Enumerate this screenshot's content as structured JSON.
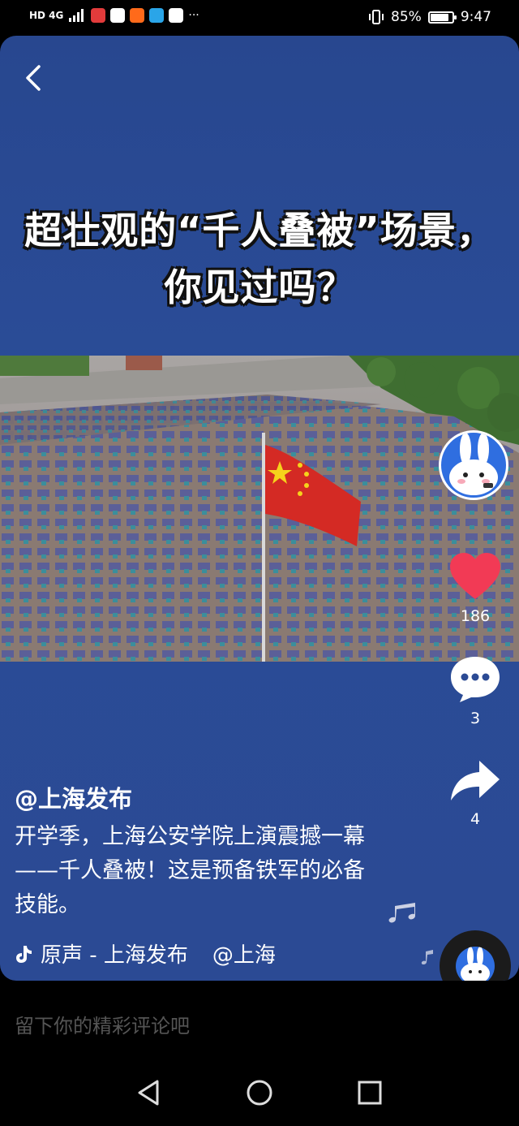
{
  "status_bar": {
    "network": "HD 4G",
    "battery_percent": "85%",
    "battery_level": 0.85,
    "time": "9:47",
    "more": "···"
  },
  "video": {
    "headline_line1": "超壮观的“千人叠被”场景，",
    "headline_line2": "你见过吗？"
  },
  "rail": {
    "like_count": "186",
    "comment_count": "3",
    "share_count": "4",
    "like_color": "#f23a55"
  },
  "post": {
    "author": "@上海发布",
    "caption": "开学季，上海公安学院上演震撼一幕——千人叠被！这是预备铁军的必备技能。",
    "music": "原声 - 上海发布",
    "music_author": "@上海"
  },
  "comment_input": {
    "placeholder": "留下你的精彩评论吧"
  }
}
